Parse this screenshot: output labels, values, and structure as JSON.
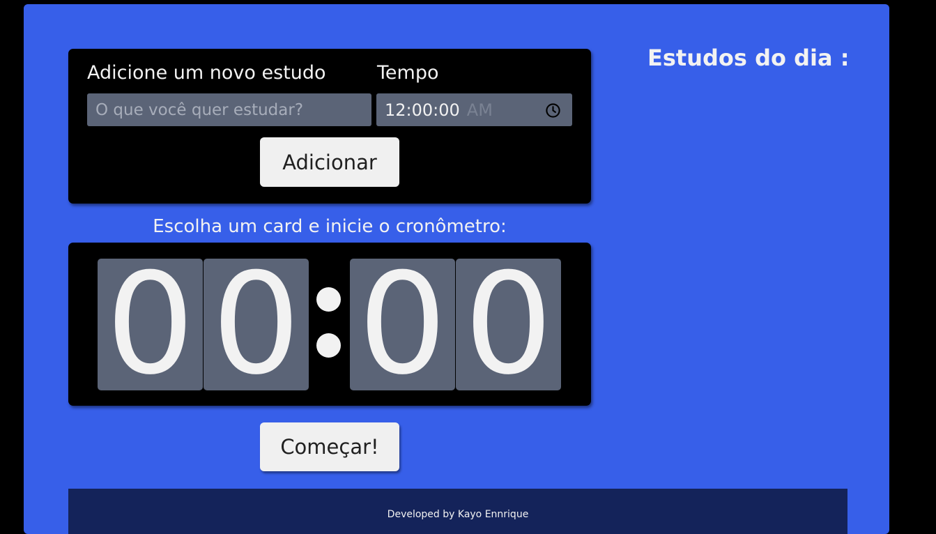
{
  "form": {
    "study_label": "Adicione um novo estudo",
    "time_label": "Tempo",
    "study_placeholder": "O que você quer estudar?",
    "time_value": "12:00:00",
    "time_ampm": "AM",
    "add_button": "Adicionar"
  },
  "chrono": {
    "title": "Escolha um card e inicie o cronômetro:",
    "digits": [
      "0",
      "0",
      "0",
      "0"
    ],
    "start_button": "Começar!"
  },
  "sidebar": {
    "title": "Estudos do dia :"
  },
  "footer": {
    "text": "Developed by Kayo Ennrique"
  },
  "colors": {
    "background": "#375fe9",
    "card": "#000000",
    "digit_bg": "#5b6477",
    "footer": "#14235a"
  },
  "icons": {
    "time_picker": "clock-icon"
  }
}
